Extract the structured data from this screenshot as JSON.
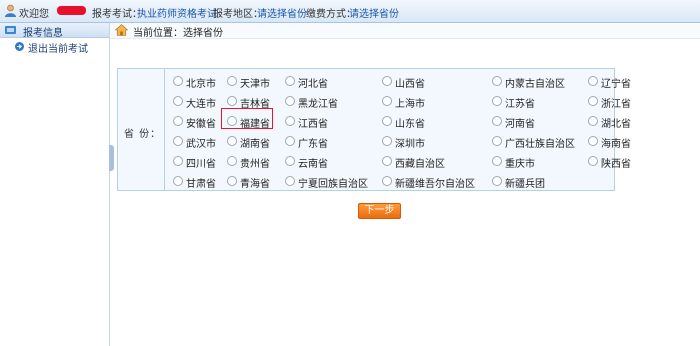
{
  "topbar": {
    "welcome": "欢迎您",
    "exam_label": "报考考试：",
    "exam_value": "执业药师资格考试",
    "region_label": "报考地区：",
    "region_value": "请选择省份",
    "pay_label": "缴费方式：",
    "pay_value": "请选择省份"
  },
  "sidebar": {
    "header": "报考信息",
    "items": [
      {
        "label": "退出当前考试"
      }
    ]
  },
  "breadcrumb": {
    "label": "当前位置：选择省份"
  },
  "province": {
    "field_label": "省  份：",
    "rows": [
      [
        "北京市",
        "天津市",
        "河北省",
        "山西省",
        "内蒙古自治区",
        "辽宁省"
      ],
      [
        "大连市",
        "吉林省",
        "黑龙江省",
        "上海市",
        "江苏省",
        "浙江省"
      ],
      [
        "安徽省",
        "福建省",
        "江西省",
        "山东省",
        "河南省",
        "湖北省"
      ],
      [
        "武汉市",
        "湖南省",
        "广东省",
        "深圳市",
        "广西壮族自治区",
        "海南省"
      ],
      [
        "四川省",
        "贵州省",
        "云南省",
        "西藏自治区",
        "重庆市",
        "陕西省"
      ],
      [
        "甘肃省",
        "青海省",
        "宁夏回族自治区",
        "新疆维吾尔自治区",
        "新疆兵团"
      ]
    ],
    "highlighted": "福建省"
  },
  "next_button": {
    "label": "下一步"
  },
  "colors": {
    "accent": "#1a57a6",
    "button": "#f07d1f",
    "highlight": "#e8162a"
  }
}
